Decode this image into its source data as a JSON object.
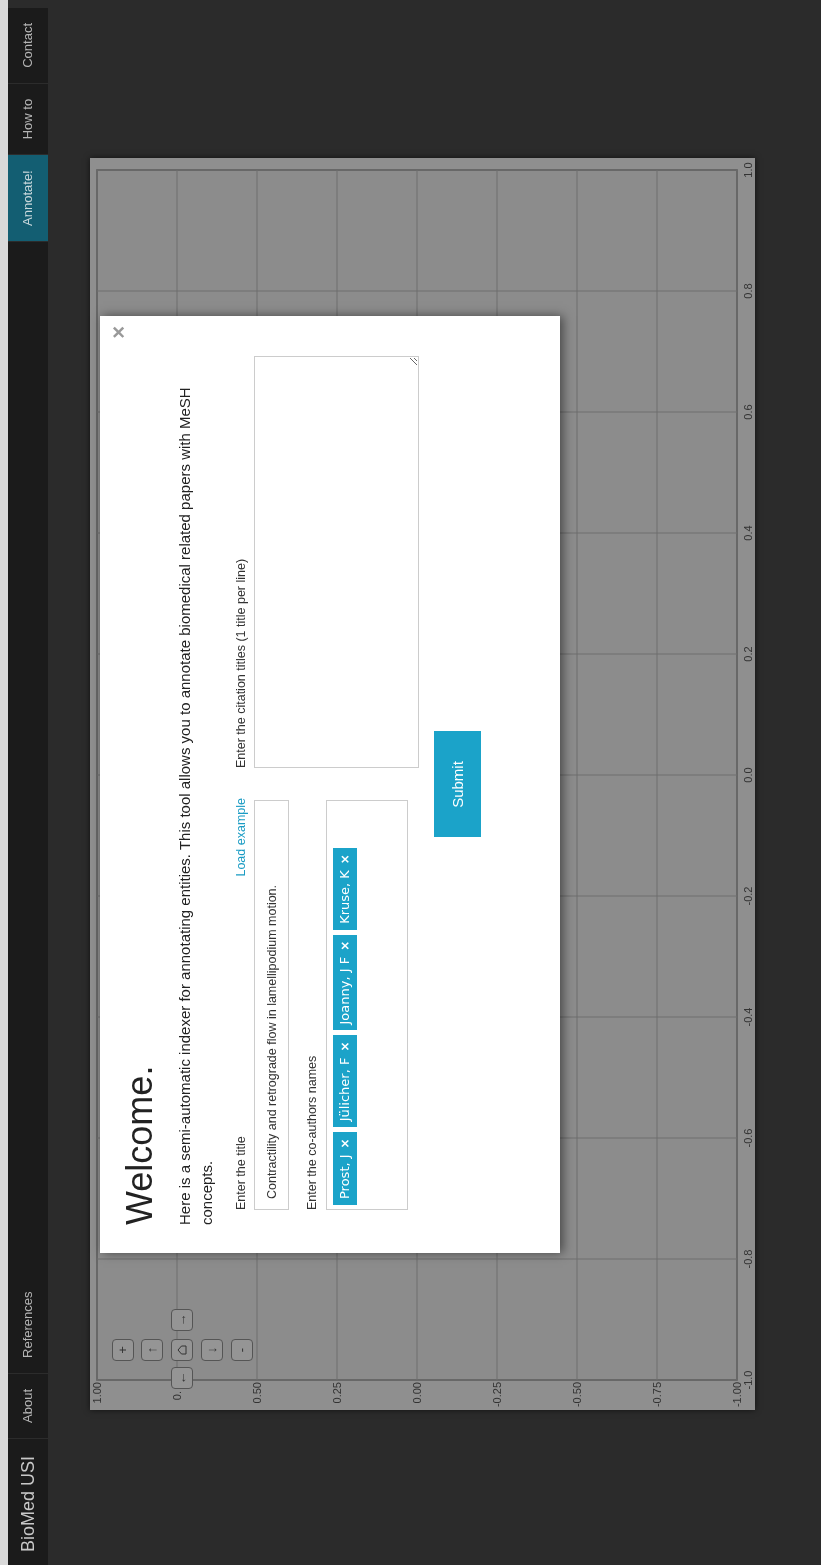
{
  "navbar": {
    "brand": "BioMed USI",
    "left_items": [
      {
        "label": "About",
        "selected": false
      },
      {
        "label": "References",
        "selected": false
      }
    ],
    "right_items": [
      {
        "label": "Annotate!",
        "selected": true
      },
      {
        "label": "How to",
        "selected": false
      },
      {
        "label": "Contact",
        "selected": false
      }
    ]
  },
  "plot": {
    "controls": [
      {
        "kind": "text",
        "label": "+"
      },
      {
        "kind": "text",
        "label": "↑"
      },
      {
        "kind": "home"
      },
      {
        "kind": "text",
        "label": "↓"
      },
      {
        "kind": "text",
        "label": "-"
      },
      {
        "kind": "text",
        "label": "←"
      },
      {
        "kind": "text",
        "label": "→"
      }
    ],
    "x_axis_labels": [
      "-1.0",
      "-0.8",
      "-0.6",
      "-0.4",
      "-0.2",
      "0.0",
      "0.2",
      "0.4",
      "0.6",
      "0.8",
      "1.0"
    ],
    "y_axis_labels": [
      "1.00",
      "0.",
      "0.50",
      "0.25",
      "0.00",
      "-0.25",
      "-0.50",
      "-0.75",
      "-1.00"
    ]
  },
  "modal": {
    "close": "×",
    "title": "Welcome.",
    "intro": "Here is a semi-automatic indexer for annotating entities. This tool allows you to annotate biomedical related papers with MeSH concepts.",
    "title_field": {
      "label": "Enter the title",
      "link": "Load example",
      "value": "Contractility and retrograde flow in lamellipodium motion."
    },
    "authors_field": {
      "label": "Enter the co-authors names",
      "tags": [
        {
          "label": "Prost, J",
          "remove": "×"
        },
        {
          "label": "Jülicher, F",
          "remove": "×"
        },
        {
          "label": "Joanny, J F",
          "remove": "×"
        },
        {
          "label": "Kruse, K",
          "remove": "×"
        }
      ]
    },
    "citations_field": {
      "label": "Enter the citation titles (1 title per line)"
    },
    "submit": "Submit"
  }
}
